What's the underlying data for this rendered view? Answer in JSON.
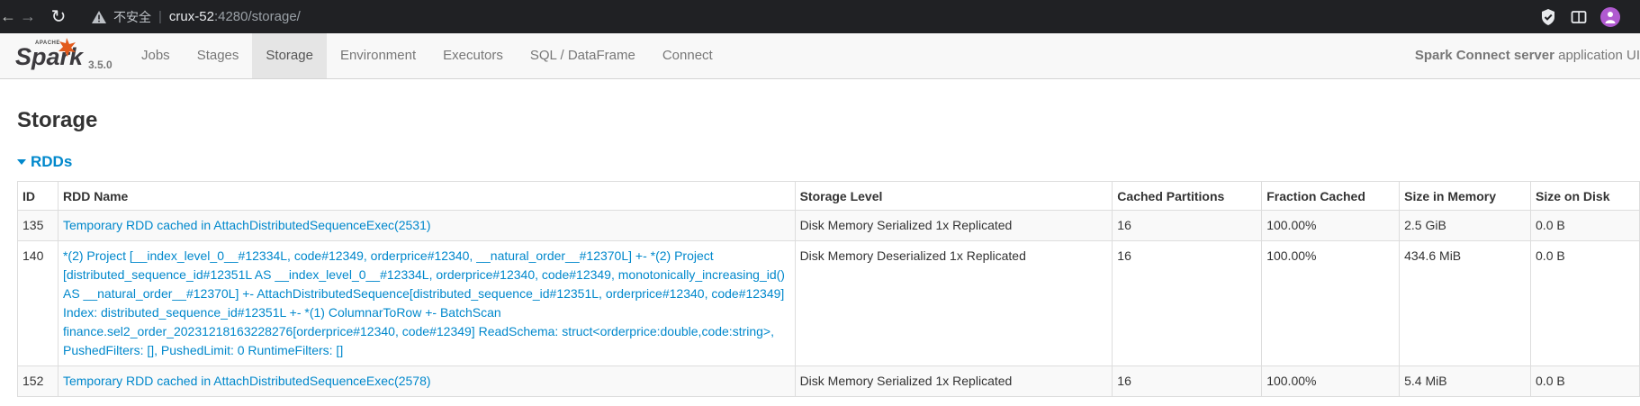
{
  "browser": {
    "insecure_label": "不安全",
    "url_host": "crux-52",
    "url_path": ":4280/storage/"
  },
  "spark": {
    "version": "3.5.0",
    "logo_text": "Spark",
    "logo_subtext": "APACHE",
    "nav": [
      "Jobs",
      "Stages",
      "Storage",
      "Environment",
      "Executors",
      "SQL / DataFrame",
      "Connect"
    ],
    "active_tab": "Storage",
    "app_name_bold": "Spark Connect server",
    "app_name_suffix": " application UI"
  },
  "page": {
    "title": "Storage",
    "section": "RDDs"
  },
  "table": {
    "headers": [
      "ID",
      "RDD Name",
      "Storage Level",
      "Cached Partitions",
      "Fraction Cached",
      "Size in Memory",
      "Size on Disk"
    ],
    "rows": [
      {
        "id": "135",
        "name": "Temporary RDD cached in AttachDistributedSequenceExec(2531)",
        "level": "Disk Memory Serialized 1x Replicated",
        "partitions": "16",
        "fraction": "100.00%",
        "memory": "2.5 GiB",
        "disk": "0.0 B"
      },
      {
        "id": "140",
        "name": "*(2) Project [__index_level_0__#12334L, code#12349, orderprice#12340, __natural_order__#12370L] +- *(2) Project [distributed_sequence_id#12351L AS __index_level_0__#12334L, orderprice#12340, code#12349, monotonically_increasing_id() AS __natural_order__#12370L] +- AttachDistributedSequence[distributed_sequence_id#12351L, orderprice#12340, code#12349] Index: distributed_sequence_id#12351L +- *(1) ColumnarToRow +- BatchScan finance.sel2_order_20231218163228276[orderprice#12340, code#12349] ReadSchema: struct<orderprice:double,code:string>, PushedFilters: [], PushedLimit: 0 RuntimeFilters: []",
        "level": "Disk Memory Deserialized 1x Replicated",
        "partitions": "16",
        "fraction": "100.00%",
        "memory": "434.6 MiB",
        "disk": "0.0 B"
      },
      {
        "id": "152",
        "name": "Temporary RDD cached in AttachDistributedSequenceExec(2578)",
        "level": "Disk Memory Serialized 1x Replicated",
        "partitions": "16",
        "fraction": "100.00%",
        "memory": "5.4 MiB",
        "disk": "0.0 B"
      }
    ]
  }
}
